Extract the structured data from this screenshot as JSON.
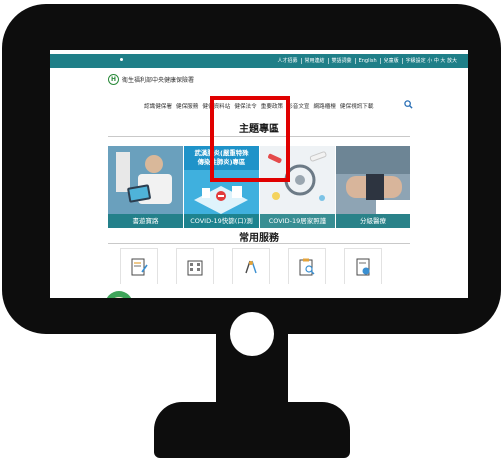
{
  "site": {
    "logo_text": "衛生福利部中央健康保險署",
    "logo_mark": "H",
    "top_links": [
      "人才招募",
      "常用連結",
      "雙語詞彙",
      "English",
      "兒童版",
      "字級設定 小 中 大 放大"
    ]
  },
  "nav": {
    "items": [
      "認識健保署",
      "健保服務",
      "健保資料站",
      "健保法令",
      "重要政策",
      "影音文宣",
      "網路櫃檯",
      "健保視訊下載"
    ]
  },
  "sections": {
    "featured_title": "主題專區",
    "quick_title": "常用服務"
  },
  "tiles": [
    {
      "caption": "書遊寶路"
    },
    {
      "head_line1": "武漢肺炎(嚴重特殊",
      "head_line2": "傳染性肺炎)專區",
      "caption": "COVID-19快篩(口)測"
    },
    {
      "caption": "COVID-19居家照護"
    },
    {
      "caption": "分級醫療"
    }
  ],
  "quick_links": [
    {
      "icon": "document-edit-icon"
    },
    {
      "icon": "building-icon"
    },
    {
      "icon": "medical-tools-icon"
    },
    {
      "icon": "clipboard-search-icon"
    },
    {
      "icon": "file-info-icon"
    }
  ],
  "colors": {
    "top_bar": "#1f7f88",
    "highlight": "#e00000",
    "frame": "#0d0d0d"
  }
}
